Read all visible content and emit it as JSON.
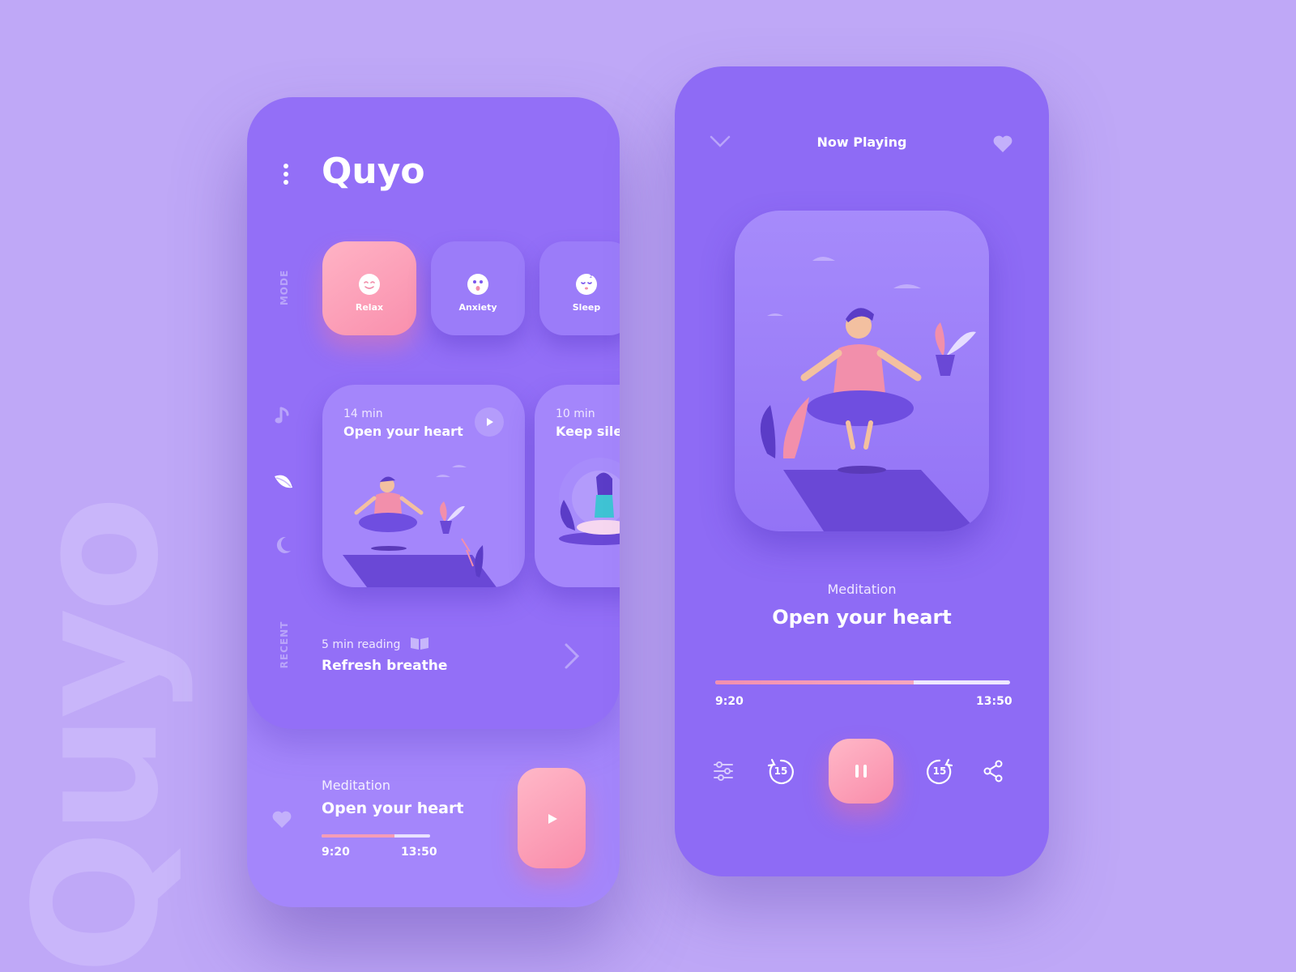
{
  "background_word": "Quyo",
  "colors": {
    "background": "#bfa8f7",
    "phone_purple": "#936ff7",
    "accent_pink": "#f98fad"
  },
  "left_phone": {
    "brand": "Quyo",
    "mode_label": "MODE",
    "recent_label": "RECENT",
    "modes": [
      {
        "label": "Relax",
        "icon": "smile-face-icon",
        "active": true
      },
      {
        "label": "Anxiety",
        "icon": "surprised-face-icon",
        "active": false
      },
      {
        "label": "Sleep",
        "icon": "sleeping-face-icon",
        "active": false
      }
    ],
    "sidebar_icons": [
      "music-note-icon",
      "leaf-icon",
      "moon-icon"
    ],
    "sessions": [
      {
        "duration": "14 min",
        "title": "Open your heart"
      },
      {
        "duration": "10 min",
        "title": "Keep silence"
      }
    ],
    "recent": {
      "subtitle": "5 min reading",
      "title": "Refresh breathe"
    },
    "now_playing": {
      "category": "Meditation",
      "title": "Open your heart",
      "elapsed": "9:20",
      "total": "13:50",
      "progress": 0.674
    }
  },
  "right_phone": {
    "header_title": "Now Playing",
    "category": "Meditation",
    "title": "Open your heart",
    "elapsed": "9:20",
    "total": "13:50",
    "progress": 0.674,
    "rewind_seconds": "15",
    "forward_seconds": "15"
  }
}
